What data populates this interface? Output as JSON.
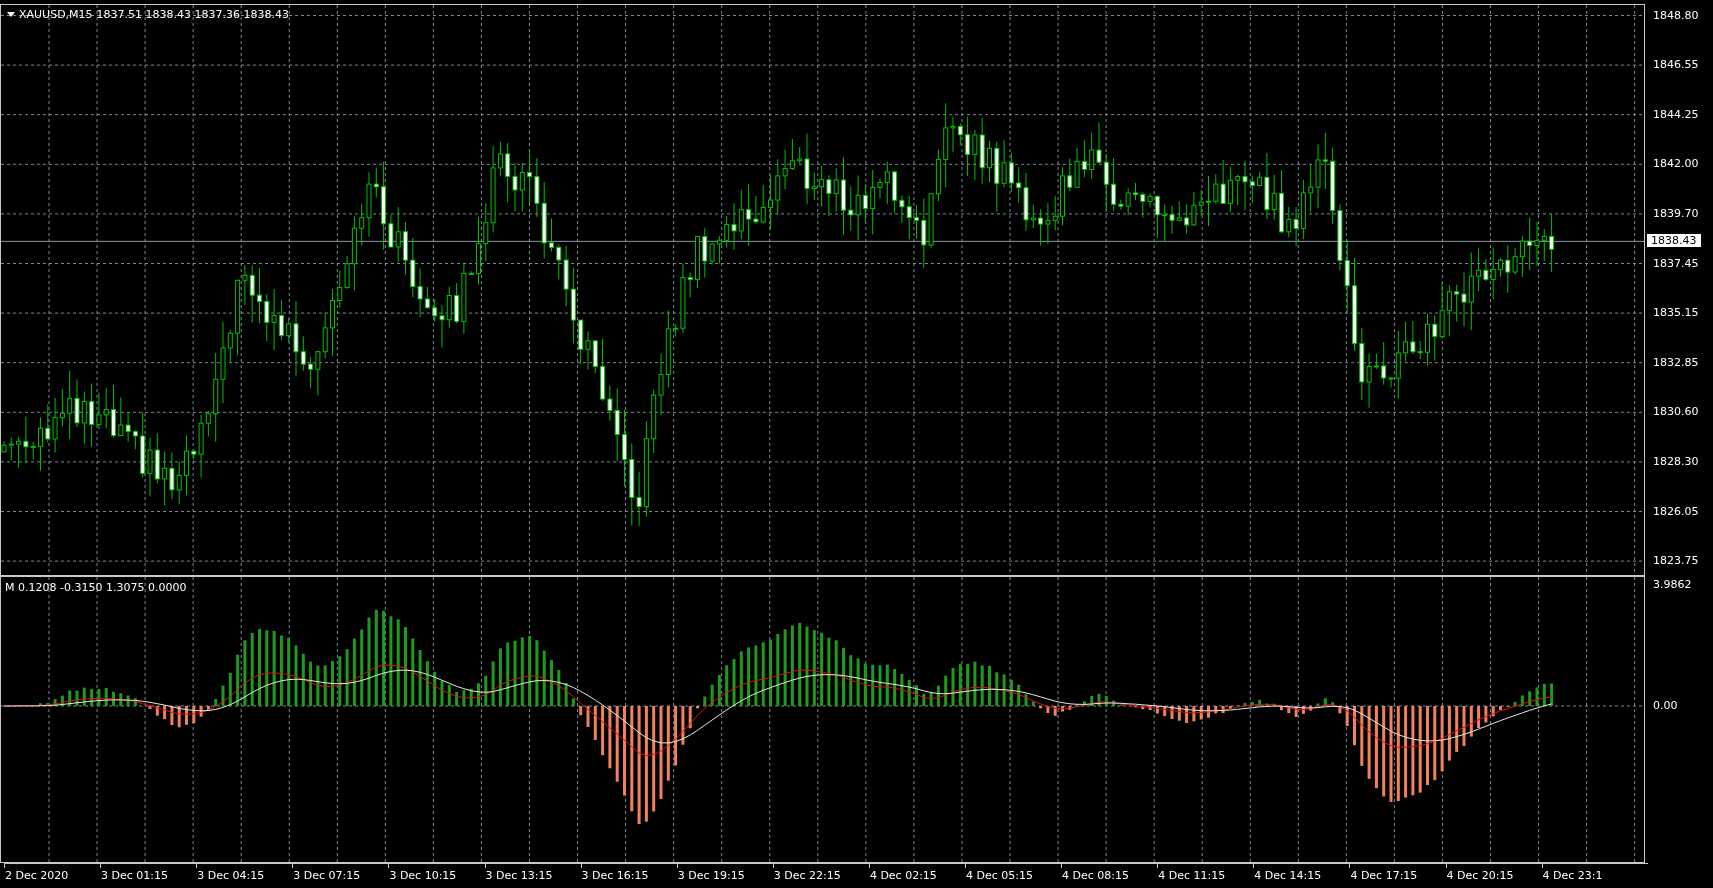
{
  "chart": {
    "symbol": "XAUUSD,M15",
    "ohlc": "1837.51 1838.43 1837.36 1838.43",
    "current_price": "1838.43",
    "price_axis": [
      "1848.80",
      "1846.55",
      "1844.25",
      "1842.00",
      "1839.70",
      "1837.45",
      "1835.15",
      "1832.85",
      "1830.60",
      "1828.30",
      "1826.05",
      "1823.75"
    ]
  },
  "indicator": {
    "label": "M 0.1208 -0.3150 1.3075 0.0000",
    "top_value": "3.9862",
    "zero_value": "0.00"
  },
  "time_axis": [
    "2 Dec 2020",
    "3 Dec 01:15",
    "3 Dec 04:15",
    "3 Dec 07:15",
    "3 Dec 10:15",
    "3 Dec 13:15",
    "3 Dec 16:15",
    "3 Dec 19:15",
    "3 Dec 22:15",
    "4 Dec 02:15",
    "4 Dec 05:15",
    "4 Dec 08:15",
    "4 Dec 11:15",
    "4 Dec 14:15",
    "4 Dec 17:15",
    "4 Dec 20:15",
    "4 Dec 23:1"
  ]
}
